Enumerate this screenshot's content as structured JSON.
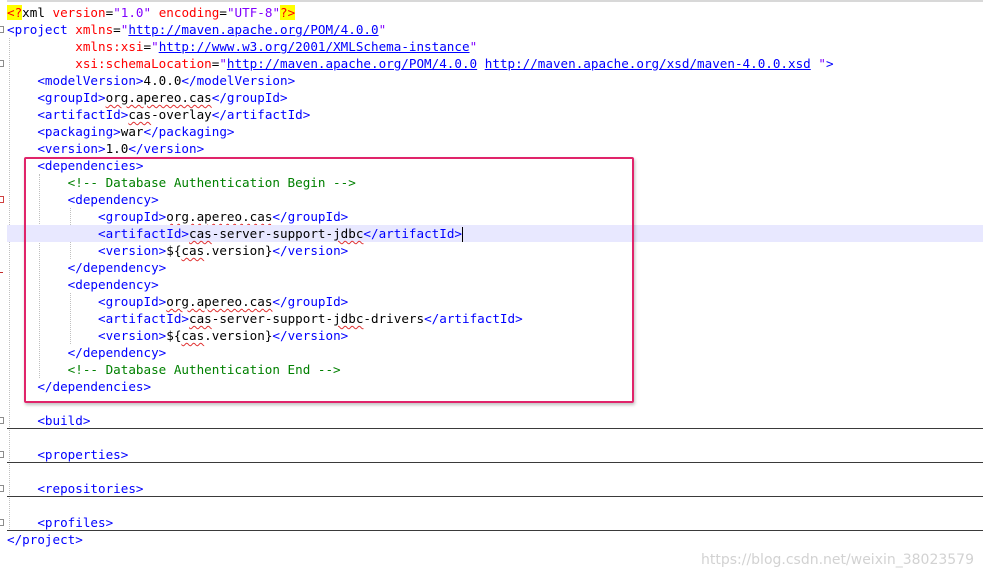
{
  "editor": {
    "lines": [
      {
        "parts": [
          [
            "pi",
            "<?"
          ],
          [
            "txt",
            "xml "
          ],
          [
            "a",
            "version"
          ],
          [
            "txt",
            "="
          ],
          [
            "v",
            "\"1.0\""
          ],
          [
            "txt",
            " "
          ],
          [
            "a",
            "encoding"
          ],
          [
            "txt",
            "="
          ],
          [
            "v",
            "\"UTF-8\""
          ],
          [
            "pi",
            "?>"
          ]
        ]
      },
      {
        "parts": [
          [
            "t",
            "<project "
          ],
          [
            "a",
            "xmlns"
          ],
          [
            "txt",
            "="
          ],
          [
            "v",
            "\""
          ],
          [
            "u",
            "http://maven.apache.org/POM/4.0.0"
          ],
          [
            "v",
            "\""
          ]
        ]
      },
      {
        "parts": [
          [
            "txt",
            "         "
          ],
          [
            "a",
            "xmlns:xsi"
          ],
          [
            "txt",
            "="
          ],
          [
            "v",
            "\""
          ],
          [
            "u",
            "http://www.w3.org/2001/XMLSchema-instance"
          ],
          [
            "v",
            "\""
          ]
        ]
      },
      {
        "parts": [
          [
            "txt",
            "         "
          ],
          [
            "a",
            "xsi:schemaLocation"
          ],
          [
            "txt",
            "="
          ],
          [
            "v",
            "\""
          ],
          [
            "u",
            "http://maven.apache.org/POM/4.0.0"
          ],
          [
            "txt",
            " "
          ],
          [
            "u",
            "http://maven.apache.org/xsd/maven-4.0.0.xsd"
          ],
          [
            "v",
            " \""
          ],
          [
            "t",
            ">"
          ]
        ]
      },
      {
        "parts": [
          [
            "txt",
            "    "
          ],
          [
            "t",
            "<modelVersion>"
          ],
          [
            "txt",
            "4.0.0"
          ],
          [
            "t",
            "</modelVersion>"
          ]
        ]
      },
      {
        "parts": [
          [
            "txt",
            "    "
          ],
          [
            "t",
            "<groupId>"
          ],
          [
            "sq",
            "org.apereo.cas"
          ],
          [
            "t",
            "</groupId>"
          ]
        ]
      },
      {
        "parts": [
          [
            "txt",
            "    "
          ],
          [
            "t",
            "<artifactId>"
          ],
          [
            "sq",
            "cas"
          ],
          [
            "txt",
            "-overlay"
          ],
          [
            "t",
            "</artifactId>"
          ]
        ]
      },
      {
        "parts": [
          [
            "txt",
            "    "
          ],
          [
            "t",
            "<packaging>"
          ],
          [
            "txt",
            "war"
          ],
          [
            "t",
            "</packaging>"
          ]
        ]
      },
      {
        "parts": [
          [
            "txt",
            "    "
          ],
          [
            "t",
            "<version>"
          ],
          [
            "txt",
            "1.0"
          ],
          [
            "t",
            "</version>"
          ]
        ]
      },
      {
        "parts": [
          [
            "txt",
            "    "
          ],
          [
            "t",
            "<dependencies>"
          ]
        ]
      },
      {
        "parts": [
          [
            "txt",
            "        "
          ],
          [
            "c",
            "<!-- Database Authentication Begin -->"
          ]
        ]
      },
      {
        "parts": [
          [
            "txt",
            "        "
          ],
          [
            "t",
            "<dependency>"
          ]
        ]
      },
      {
        "parts": [
          [
            "txt",
            "            "
          ],
          [
            "t",
            "<groupId>"
          ],
          [
            "sq",
            "org.apereo.cas"
          ],
          [
            "t",
            "</groupId>"
          ]
        ]
      },
      {
        "parts": [
          [
            "txt",
            "            "
          ],
          [
            "t",
            "<artifactId>"
          ],
          [
            "sq",
            "cas"
          ],
          [
            "txt",
            "-server-support-"
          ],
          [
            "sq",
            "jdbc"
          ],
          [
            "t",
            "</artifactId>"
          ]
        ],
        "current": true
      },
      {
        "parts": [
          [
            "txt",
            "            "
          ],
          [
            "t",
            "<version>"
          ],
          [
            "txt",
            "${"
          ],
          [
            "sq",
            "cas"
          ],
          [
            "txt",
            ".version}"
          ],
          [
            "t",
            "</version>"
          ]
        ]
      },
      {
        "parts": [
          [
            "txt",
            "        "
          ],
          [
            "t",
            "</dependency>"
          ]
        ]
      },
      {
        "parts": [
          [
            "txt",
            "        "
          ],
          [
            "t",
            "<dependency>"
          ]
        ]
      },
      {
        "parts": [
          [
            "txt",
            "            "
          ],
          [
            "t",
            "<groupId>"
          ],
          [
            "sq",
            "org.apereo.cas"
          ],
          [
            "t",
            "</groupId>"
          ]
        ]
      },
      {
        "parts": [
          [
            "txt",
            "            "
          ],
          [
            "t",
            "<artifactId>"
          ],
          [
            "sq",
            "cas"
          ],
          [
            "txt",
            "-server-support-"
          ],
          [
            "sq",
            "jdbc"
          ],
          [
            "txt",
            "-drivers"
          ],
          [
            "t",
            "</artifactId>"
          ]
        ]
      },
      {
        "parts": [
          [
            "txt",
            "            "
          ],
          [
            "t",
            "<version>"
          ],
          [
            "txt",
            "${"
          ],
          [
            "sq",
            "cas"
          ],
          [
            "txt",
            ".version}"
          ],
          [
            "t",
            "</version>"
          ]
        ]
      },
      {
        "parts": [
          [
            "txt",
            "        "
          ],
          [
            "t",
            "</dependency>"
          ]
        ]
      },
      {
        "parts": [
          [
            "txt",
            "        "
          ],
          [
            "c",
            "<!-- Database Authentication End -->"
          ]
        ]
      },
      {
        "parts": [
          [
            "txt",
            "    "
          ],
          [
            "t",
            "</dependencies>"
          ]
        ]
      },
      {
        "parts": []
      },
      {
        "parts": [
          [
            "txt",
            "    "
          ],
          [
            "t",
            "<build>"
          ]
        ],
        "folded": true
      },
      {
        "parts": []
      },
      {
        "parts": [
          [
            "txt",
            "    "
          ],
          [
            "t",
            "<properties>"
          ]
        ],
        "folded": true
      },
      {
        "parts": []
      },
      {
        "parts": [
          [
            "txt",
            "    "
          ],
          [
            "t",
            "<repositories>"
          ]
        ],
        "folded": true
      },
      {
        "parts": []
      },
      {
        "parts": [
          [
            "txt",
            "    "
          ],
          [
            "t",
            "<profiles>"
          ]
        ],
        "folded": true
      },
      {
        "parts": [
          [
            "t",
            "</project>"
          ]
        ]
      }
    ]
  },
  "watermark": {
    "text": "https://blog.csdn.net/weixin_38023579"
  },
  "colors": {
    "tag": "#0000ff",
    "attribute": "#ff0000",
    "value": "#8000ff",
    "comment": "#008000",
    "processing_instruction_bg": "#ffff00",
    "current_line_bg": "#e8e8ff",
    "highlight_box": "#e0246a"
  }
}
